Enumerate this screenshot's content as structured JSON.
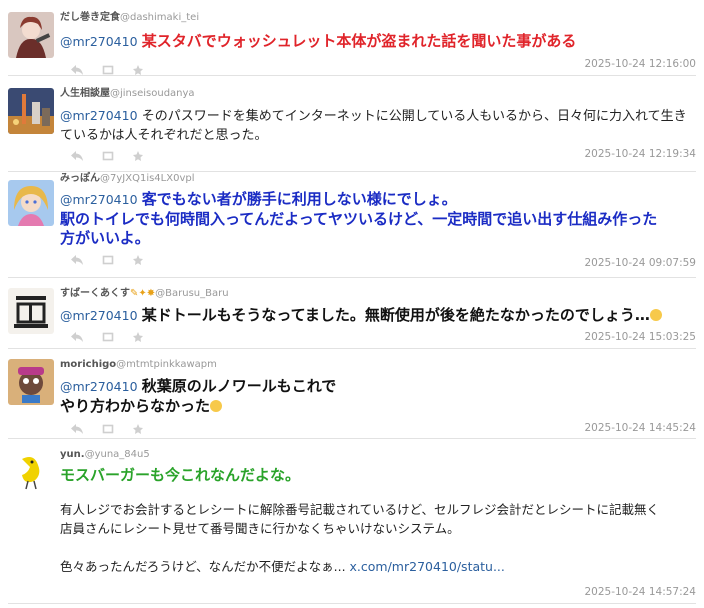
{
  "posts": [
    {
      "display_name": "だし巻き定食",
      "handle": "@dashimaki_tei",
      "mention": "@mr270410",
      "lines": [
        "某スタバでウォッシュレット本体が盗まれた話を聞いた事がある"
      ],
      "timestamp": "2025-10-24 12:16:00"
    },
    {
      "display_name": "人生相談屋",
      "handle": "@jinseisoudanya",
      "mention": "@mr270410",
      "lines": [
        "そのパスワードを集めてインターネットに公開している人もいるから、日々何に力入れて生き",
        "ているかは人それぞれだと思った。"
      ],
      "timestamp": "2025-10-24 12:19:34"
    },
    {
      "display_name": "みっぽん",
      "handle": "@7yJXQ1is4LX0vpl",
      "mention": "@mr270410",
      "lines": [
        "客でもない者が勝手に利用しない様にでしょ。",
        "駅のトイレでも何時間入ってんだよってヤツいるけど、一定時間で追い出す仕組み作った",
        "方がいいよ。"
      ],
      "timestamp": "2025-10-24 09:07:59"
    },
    {
      "display_name": "すばーくあくす",
      "handle": "@Barusu_Baru",
      "mention": "@mr270410",
      "lines": [
        "某ドトールもそうなってました。無断使用が後を絶たなかったのでしょう…"
      ],
      "timestamp": "2025-10-24 15:03:25"
    },
    {
      "display_name": "morichigo",
      "handle": "@mtmtpinkkawapm",
      "mention": "@mr270410",
      "lines": [
        "秋葉原のルノワールもこれで",
        "やり方わからなかった"
      ],
      "timestamp": "2025-10-24 14:45:24"
    },
    {
      "display_name": "yun.",
      "handle": "@yuna_84u5",
      "title": "モスバーガーも今これなんだよな。",
      "lines": [
        "有人レジでお会計するとレシートに解除番号記載されているけど、セルフレジ会計だとレシートに記載無く",
        "店員さんにレシート見せて番号聞きに行かなくちゃいけないシステム。",
        "色々あったんだろうけど、なんだか不便だよなぁ..."
      ],
      "link": "x.com/mr270410/statu...",
      "timestamp": "2025-10-24 14:57:24"
    }
  ],
  "colors": {
    "red_text": "#e0242a",
    "blue_text": "#1b2cc4",
    "green_text": "#2aa32a",
    "mention": "#2b5f9e",
    "meta": "#999999"
  },
  "icons": [
    "reply-icon",
    "retweet-icon",
    "like-icon"
  ]
}
